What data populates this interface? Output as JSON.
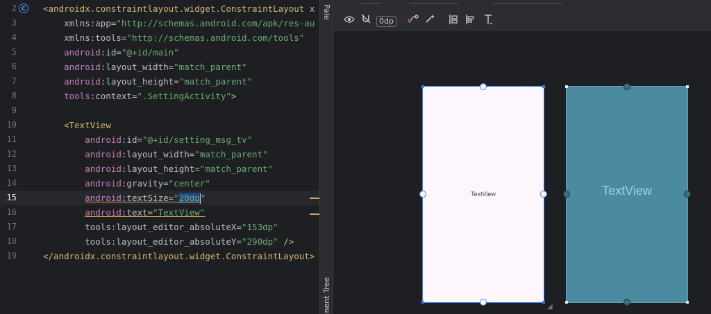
{
  "editor": {
    "lines": [
      {
        "n": "2",
        "parts": [
          {
            "t": "tag",
            "v": "<androidx.constraintlayout.widget.ConstraintLayout "
          },
          {
            "t": "attr",
            "v": "x"
          }
        ]
      },
      {
        "n": "3",
        "parts": [
          {
            "t": "pad",
            "v": "    "
          },
          {
            "t": "attr",
            "v": "xmlns:app="
          },
          {
            "t": "val",
            "v": "\"http://schemas.android.com/apk/res-au"
          }
        ]
      },
      {
        "n": "4",
        "parts": [
          {
            "t": "pad",
            "v": "    "
          },
          {
            "t": "attr",
            "v": "xmlns:tools="
          },
          {
            "t": "val",
            "v": "\"http://schemas.android.com/tools\""
          }
        ]
      },
      {
        "n": "5",
        "parts": [
          {
            "t": "pad",
            "v": "    "
          },
          {
            "t": "ns",
            "v": "android"
          },
          {
            "t": "attr",
            "v": ":id="
          },
          {
            "t": "val",
            "v": "\"@+id/main\""
          }
        ]
      },
      {
        "n": "6",
        "parts": [
          {
            "t": "pad",
            "v": "    "
          },
          {
            "t": "ns",
            "v": "android"
          },
          {
            "t": "attr",
            "v": ":layout_width="
          },
          {
            "t": "val",
            "v": "\"match_parent\""
          }
        ]
      },
      {
        "n": "7",
        "parts": [
          {
            "t": "pad",
            "v": "    "
          },
          {
            "t": "ns",
            "v": "android"
          },
          {
            "t": "attr",
            "v": ":layout_height="
          },
          {
            "t": "val",
            "v": "\"match_parent\""
          }
        ]
      },
      {
        "n": "8",
        "parts": [
          {
            "t": "pad",
            "v": "    "
          },
          {
            "t": "ns",
            "v": "tools"
          },
          {
            "t": "attr",
            "v": ":context="
          },
          {
            "t": "val",
            "v": "\".SettingActivity\""
          },
          {
            "t": "tag",
            "v": ">"
          }
        ]
      },
      {
        "n": "9",
        "parts": []
      },
      {
        "n": "10",
        "parts": [
          {
            "t": "pad",
            "v": "    "
          },
          {
            "t": "tag",
            "v": "<TextView"
          }
        ]
      },
      {
        "n": "11",
        "parts": [
          {
            "t": "pad",
            "v": "        "
          },
          {
            "t": "ns",
            "v": "android"
          },
          {
            "t": "attr",
            "v": ":id="
          },
          {
            "t": "val",
            "v": "\"@+id/setting_msg_tv\""
          }
        ]
      },
      {
        "n": "12",
        "parts": [
          {
            "t": "pad",
            "v": "        "
          },
          {
            "t": "ns",
            "v": "android"
          },
          {
            "t": "attr",
            "v": ":layout_width="
          },
          {
            "t": "val",
            "v": "\"match_parent\""
          }
        ]
      },
      {
        "n": "13",
        "parts": [
          {
            "t": "pad",
            "v": "        "
          },
          {
            "t": "ns",
            "v": "android"
          },
          {
            "t": "attr",
            "v": ":layout_height="
          },
          {
            "t": "val",
            "v": "\"match_parent\""
          }
        ]
      },
      {
        "n": "14",
        "parts": [
          {
            "t": "pad",
            "v": "        "
          },
          {
            "t": "ns",
            "v": "android"
          },
          {
            "t": "attr",
            "v": ":gravity="
          },
          {
            "t": "val",
            "v": "\"center\""
          }
        ]
      },
      {
        "n": "15",
        "current": true,
        "parts": [
          {
            "t": "pad",
            "v": "        "
          },
          {
            "t": "ns",
            "v": "android",
            "u": true
          },
          {
            "t": "attr",
            "v": ":textSize=",
            "u": true
          },
          {
            "t": "val",
            "v": "\"",
            "u": true
          },
          {
            "t": "sel",
            "v": "20dp",
            "u": true
          },
          {
            "t": "caret",
            "v": ""
          },
          {
            "t": "val",
            "v": "\""
          }
        ]
      },
      {
        "n": "16",
        "parts": [
          {
            "t": "pad",
            "v": "        "
          },
          {
            "t": "ns",
            "v": "android",
            "u": true
          },
          {
            "t": "attr",
            "v": ":text=",
            "u": true
          },
          {
            "t": "val",
            "v": "\"TextView\"",
            "u": true
          }
        ]
      },
      {
        "n": "17",
        "parts": [
          {
            "t": "pad",
            "v": "        "
          },
          {
            "t": "tools",
            "v": "tools:layout_editor_absoluteX="
          },
          {
            "t": "val",
            "v": "\"153dp\""
          }
        ]
      },
      {
        "n": "18",
        "parts": [
          {
            "t": "pad",
            "v": "        "
          },
          {
            "t": "tools",
            "v": "tools:layout_editor_absoluteY="
          },
          {
            "t": "val",
            "v": "\"290dp\""
          },
          {
            "t": "tag",
            "v": " />"
          }
        ]
      },
      {
        "n": "19",
        "parts": [
          {
            "t": "tag",
            "v": "</androidx.constraintlayout.widget.ConstraintLayout>"
          }
        ]
      }
    ]
  },
  "side_strip": {
    "top_label": "Pale",
    "bottom_label": "nent Tree"
  },
  "toolbar": {
    "eye_icon": "eye-icon",
    "magnet_icon": "magnet-off-icon",
    "margin_value": "0dp",
    "constraint_icon": "infer-constraints-icon",
    "wand_icon": "magic-wand-icon",
    "pack_icon": "pack-icon",
    "align_icon": "align-icon",
    "guideline_icon": "guideline-icon"
  },
  "preview": {
    "blueprint_text": "TextView",
    "design_text": "TextView"
  },
  "colors": {
    "editor_bg": "#1e1f22",
    "tag": "#d5b778",
    "namespace": "#c77dbb",
    "value": "#6aab73",
    "selection_blue": "#3b7cf0",
    "device_teal": "#4a8ba1"
  }
}
